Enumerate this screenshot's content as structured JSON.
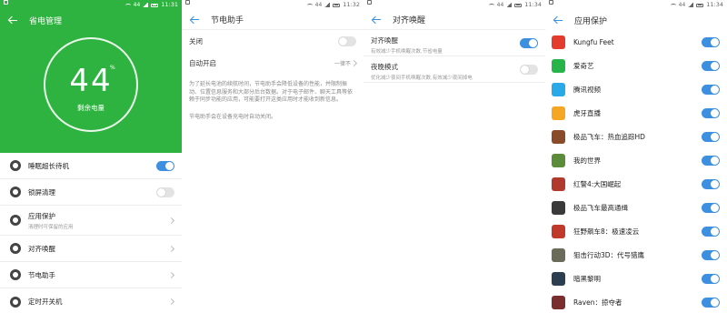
{
  "status_bars": [
    {
      "signal": "44",
      "time": "11:31"
    },
    {
      "signal": "44",
      "time": "11:32"
    },
    {
      "signal": "44",
      "time": "11:34"
    },
    {
      "signal": "44",
      "time": "11:34"
    }
  ],
  "screen1": {
    "title": "省电管理",
    "battery_value": "44",
    "battery_unit": "%",
    "battery_label": "剩余电量",
    "items": [
      {
        "label": "睡眠超长待机",
        "toggle": true
      },
      {
        "label": "锁屏清理",
        "toggle": false
      },
      {
        "label": "应用保护",
        "sub": "清理时可保留的应用",
        "chevron": true
      },
      {
        "label": "对齐唤醒",
        "chevron": true
      },
      {
        "label": "节电助手",
        "chevron": true
      },
      {
        "label": "定时开关机",
        "chevron": true
      }
    ]
  },
  "screen2": {
    "title": "节电助手",
    "off_label": "关闭",
    "auto_label": "自动开启",
    "auto_value": "一律不",
    "description": "为了延长电池的续航时间，节电助手会降低设备的性能，并限制振动、位置信息服务和大部分后台数据。对于电子邮件、聊天工具等依赖于同步功能的应用，可能要打开这类应用时才能收到新信息。",
    "note": "节电助手会在设备充电时自动关闭。"
  },
  "screen3": {
    "title": "对齐唤醒",
    "items": [
      {
        "label": "对齐唤醒",
        "desc": "有效减少手机唤醒次数,节省电量",
        "toggle": true
      },
      {
        "label": "夜晚模式",
        "desc": "优化减少夜间手机唤醒次数,有效减少夜间掉电",
        "toggle": false
      }
    ]
  },
  "screen4": {
    "title": "应用保护",
    "apps": [
      {
        "name": "Kungfu Feet",
        "color": "#e33b2e"
      },
      {
        "name": "爱奇艺",
        "color": "#27b54a"
      },
      {
        "name": "腾讯视频",
        "color": "#2aa9e8"
      },
      {
        "name": "虎牙直播",
        "color": "#f5a623"
      },
      {
        "name": "极品飞车：热血追踪HD",
        "color": "#8a4b2a"
      },
      {
        "name": "我的世界",
        "color": "#5b8c3a"
      },
      {
        "name": "红警4:大国崛起",
        "color": "#b03a2e"
      },
      {
        "name": "极品飞车最高通缉",
        "color": "#3a3a3a"
      },
      {
        "name": "狂野飙车8：极速凌云",
        "color": "#c0392b"
      },
      {
        "name": "狙击行动3D：代号猎鹰",
        "color": "#6b6b5a"
      },
      {
        "name": "暗黑黎明",
        "color": "#2c3e50"
      },
      {
        "name": "Raven：掠夺者",
        "color": "#7a2e2e"
      }
    ]
  },
  "colors": {
    "green": "#2fb340",
    "accent": "#3d8fe0"
  }
}
